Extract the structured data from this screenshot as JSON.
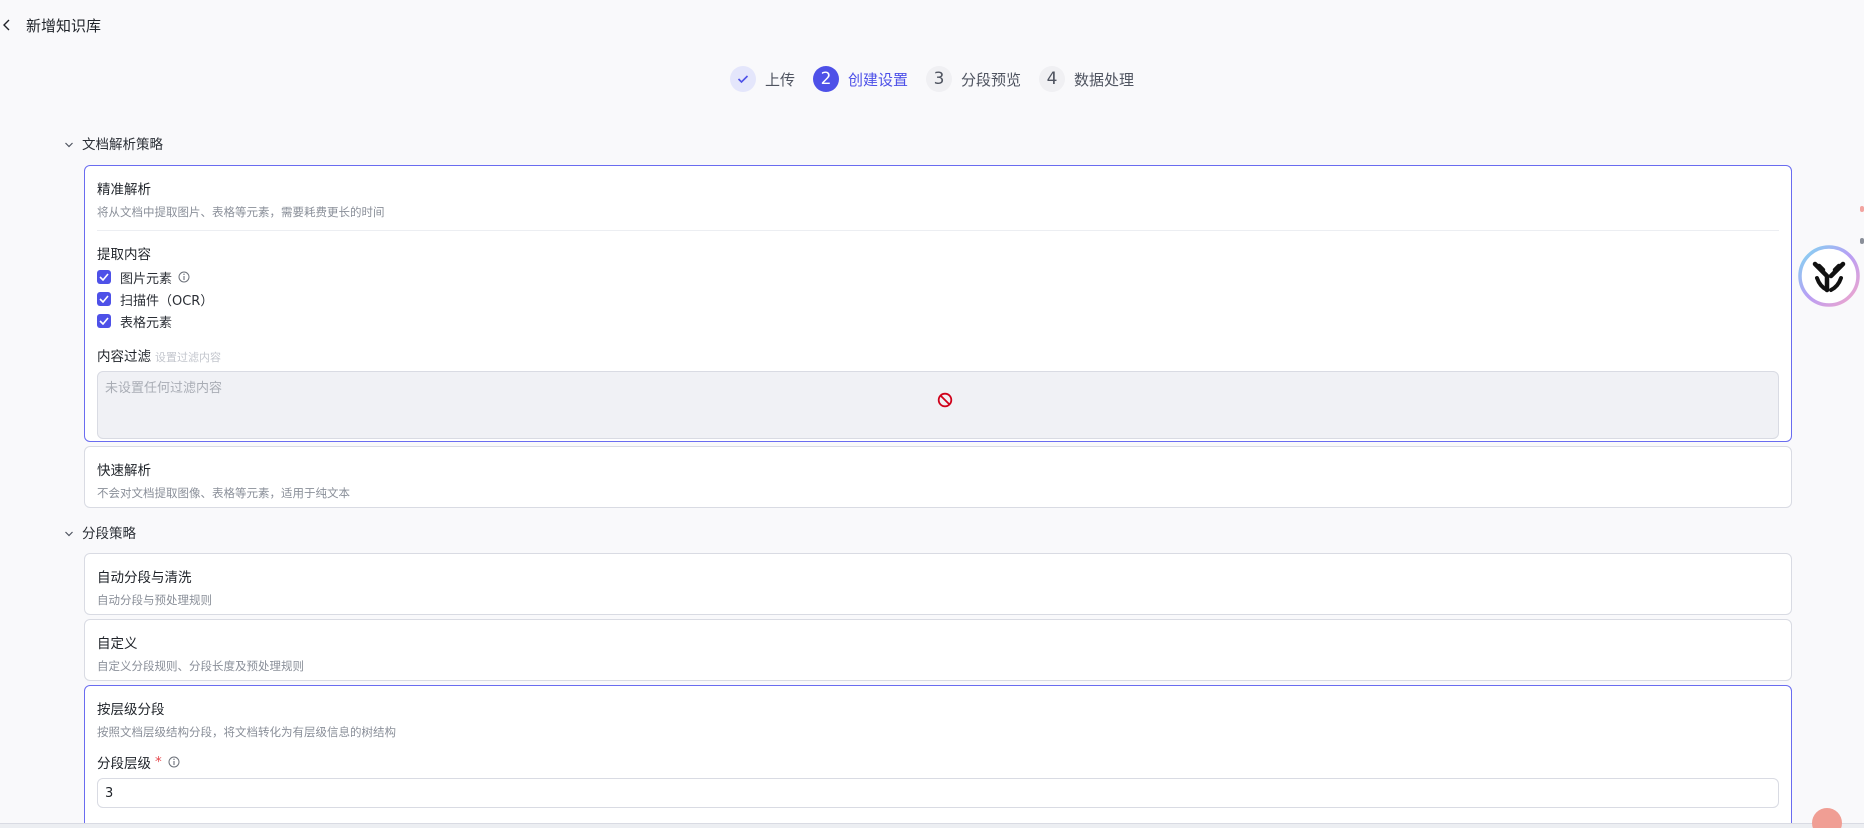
{
  "header": {
    "title": "新增知识库"
  },
  "steps": [
    {
      "label": "上传",
      "number": "",
      "state": "done"
    },
    {
      "label": "创建设置",
      "number": "2",
      "state": "active"
    },
    {
      "label": "分段预览",
      "number": "3",
      "state": "todo"
    },
    {
      "label": "数据处理",
      "number": "4",
      "state": "todo"
    }
  ],
  "parse_section": {
    "title": "文档解析策略",
    "precise": {
      "title": "精准解析",
      "desc": "将从文档中提取图片、表格等元素，需要耗费更长的时间",
      "extract_title": "提取内容",
      "options": [
        {
          "label": "图片元素",
          "checked": true
        },
        {
          "label": "扫描件（OCR）",
          "checked": true
        },
        {
          "label": "表格元素",
          "checked": true
        }
      ],
      "filter_label": "内容过滤",
      "filter_hint": "设置过滤内容",
      "filter_placeholder": "未设置任何过滤内容"
    },
    "fast": {
      "title": "快速解析",
      "desc": "不会对文档提取图像、表格等元素，适用于纯文本"
    }
  },
  "segment_section": {
    "title": "分段策略",
    "auto": {
      "title": "自动分段与清洗",
      "desc": "自动分段与预处理规则"
    },
    "custom": {
      "title": "自定义",
      "desc": "自定义分段规则、分段长度及预处理规则"
    },
    "hierarchy": {
      "title": "按层级分段",
      "desc": "按照文档层级结构分段，将文档转化为有层级信息的树结构",
      "level_label": "分段层级",
      "required_mark": "*",
      "level_value": "3"
    }
  },
  "colors": {
    "accent": "#4e51e8",
    "border": "#d9dbe3",
    "forbid": "#d0021b"
  }
}
